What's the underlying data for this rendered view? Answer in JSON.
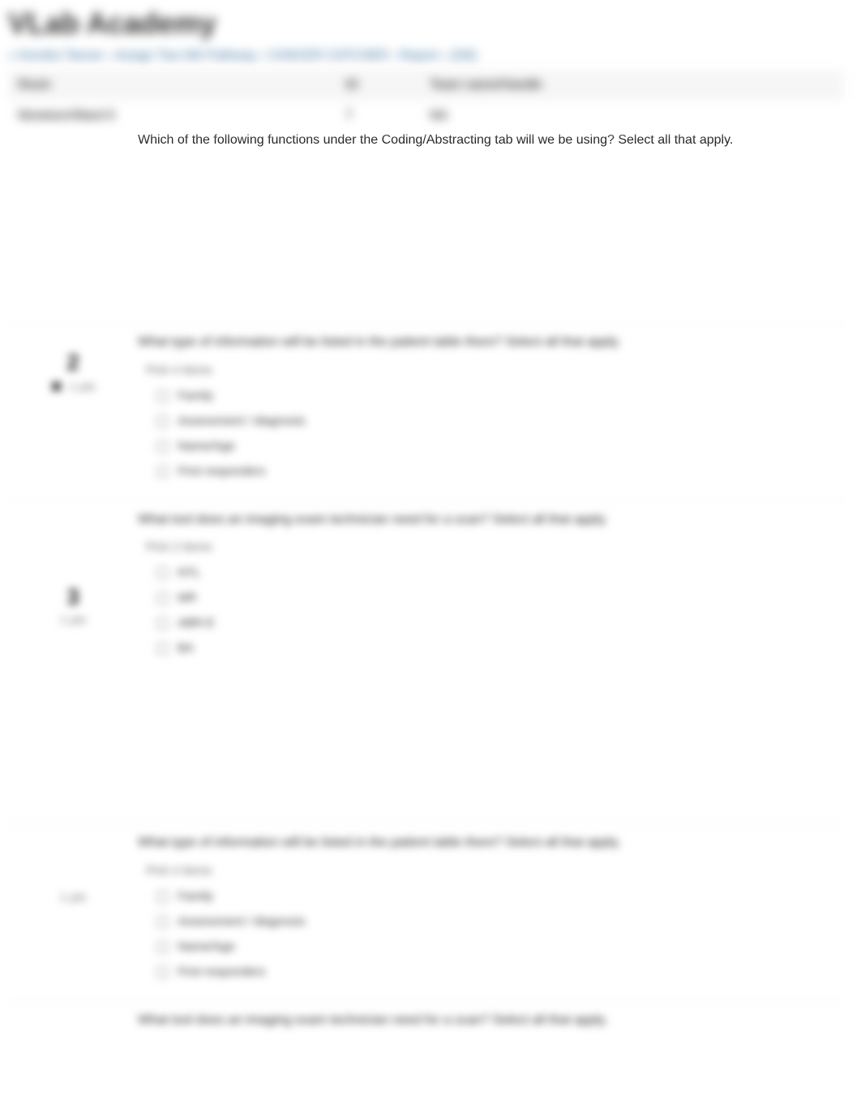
{
  "header": {
    "logo": "VLab Academy",
    "breadcrumb": "« Kendra Tanner › Assign Two MA Pathway › CANCER CATCHER › Report › (3/6)"
  },
  "info": {
    "r1c1": "Resin",
    "r1c2": "ID",
    "r1c3": "Team name/Handle",
    "r2c1": "Nineteen/Ward 6",
    "r2c2": "7",
    "r2c3": "NA"
  },
  "questions": [
    {
      "left": {
        "num": "",
        "pts": "",
        "showX": false
      },
      "prompt": "Which of the following functions under the Coding/Abstracting tab will we be using? Select all that apply.",
      "pick": "",
      "options": [],
      "tall": true,
      "clearTop": true
    },
    {
      "left": {
        "num": "2",
        "pts": "1 pts",
        "showX": true
      },
      "prompt": "What type of information will be listed in the patient table there? Select all that apply.",
      "pick": "Pick 4 Items",
      "options": [
        "Family",
        "Assessment / diagnosis",
        "Name/Age",
        "First responders"
      ],
      "tall": false
    },
    {
      "left": {
        "num": "3",
        "pts": "1 pts",
        "showX": false
      },
      "prompt": "What tool does an imaging exam technician need for a scan? Select all that apply.",
      "pick": "Pick 2 Items",
      "options": [
        "NTL",
        "MR",
        "ABR-E",
        "BA"
      ],
      "tall": true
    },
    {
      "left": {
        "num": "",
        "pts": "1 pts",
        "showX": false
      },
      "prompt": "What type of information will be listed in the patient table there? Select all that apply.",
      "pick": "Pick 4 Items",
      "options": [
        "Family",
        "Assessment / diagnosis",
        "Name/Age",
        "First responders"
      ],
      "tall": false
    },
    {
      "left": {
        "num": "",
        "pts": "",
        "showX": false
      },
      "prompt": "What tool does an imaging exam technician need for a scan? Select all that apply.",
      "pick": "",
      "options": [],
      "tall": false
    }
  ]
}
